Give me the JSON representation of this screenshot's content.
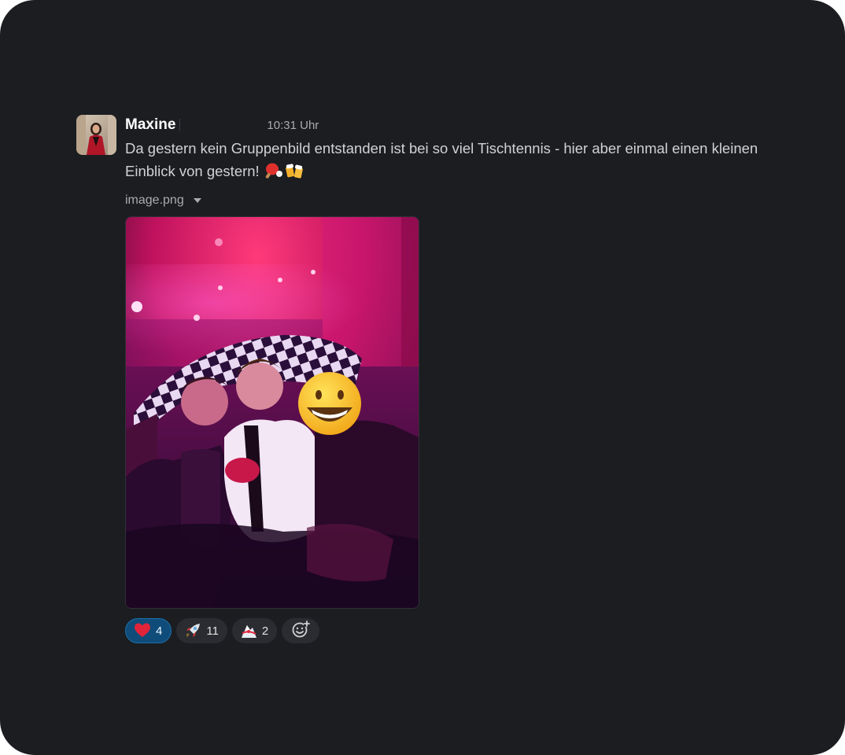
{
  "message": {
    "sender": "Maxine",
    "timestamp": "10:31 Uhr",
    "text": "Da gestern kein Gruppenbild entstanden ist bei so viel Tischtennis - hier aber einmal einen kleinen Einblick von gestern!",
    "inline_emojis": [
      "ping-pong-icon",
      "beer-mugs-icon"
    ],
    "attachment": {
      "filename": "image.png"
    }
  },
  "reactions": [
    {
      "emoji": "red-heart-icon",
      "count": "4",
      "active": true
    },
    {
      "emoji": "rocket-icon",
      "count": "11",
      "active": false
    },
    {
      "emoji": "ski-lift-icon",
      "count": "2",
      "active": false
    }
  ],
  "colors": {
    "background": "#1b1d21",
    "text": "#d1d2d3",
    "muted": "#ababad",
    "reaction_bg": "#2a2c31",
    "reaction_active_bg": "#0f4c7a",
    "reaction_active_border": "#1d6fa8"
  }
}
